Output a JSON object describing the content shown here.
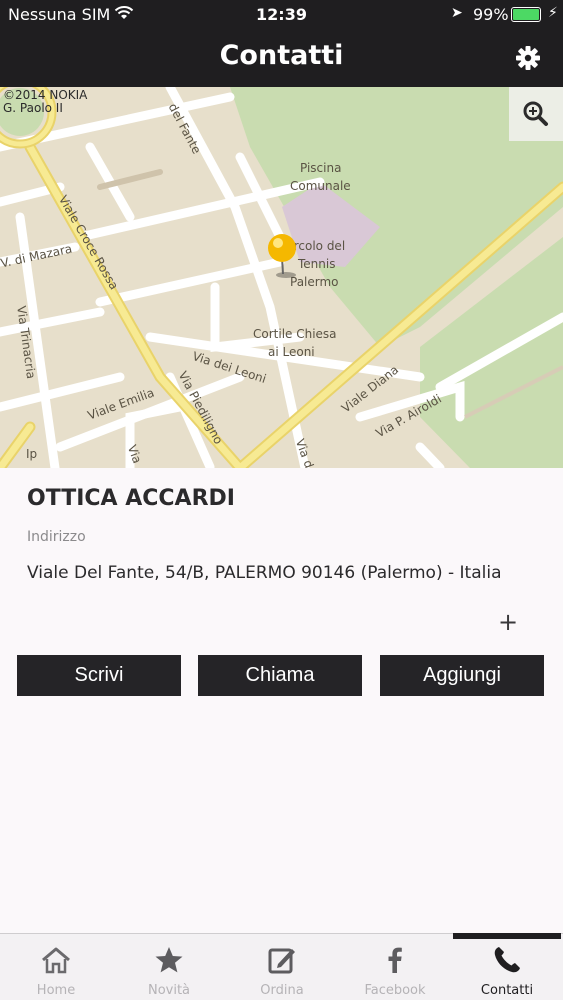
{
  "status": {
    "carrier": "Nessuna SIM",
    "time": "12:39",
    "battery_pct": "99%",
    "battery_level": 0.99,
    "battery_color": "#4cd964"
  },
  "nav": {
    "title": "Contatti",
    "settings_icon": "gear-icon"
  },
  "map": {
    "copyright_line1": "©2014 NOKIA",
    "copyright_line2": "G. Paolo II",
    "zoom_icon": "magnifier-plus-icon",
    "labels": {
      "del_fante": "del Fante",
      "piscina": "Piscina",
      "comunale": "Comunale",
      "circolo": "Circolo del",
      "tennis": "Tennis",
      "palermo": "Palermo",
      "croce_rossa": "Viale Croce Rossa",
      "mazara": "V. di Mazara",
      "trinacria": "Via Trinacria",
      "cortile": "Cortile Chiesa",
      "leoni_place": "ai Leoni",
      "via_leoni": "Via dei Leoni",
      "emilia": "Viale Emilia",
      "piediligno": "Via Piediligno",
      "diana": "Viale Diana",
      "airoldi": "Via P. Airoldi",
      "ip": "Ip",
      "via_p": "Via",
      "via_d": "Via d"
    }
  },
  "store": {
    "name": "OTTICA ACCARDI",
    "address_label": "Indirizzo",
    "address": "Viale Del Fante, 54/B, PALERMO 90146 (Palermo) - Italia",
    "expand_label": "+"
  },
  "actions": {
    "write": "Scrivi",
    "call": "Chiama",
    "add": "Aggiungi"
  },
  "tabs": [
    {
      "label": "Home",
      "icon": "home-icon"
    },
    {
      "label": "Novità",
      "icon": "star-icon"
    },
    {
      "label": "Ordina",
      "icon": "edit-icon"
    },
    {
      "label": "Facebook",
      "icon": "facebook-icon"
    },
    {
      "label": "Contatti",
      "icon": "phone-icon",
      "active": true
    }
  ],
  "colors": {
    "bar": "#1f1e20",
    "button": "#252427",
    "map_road_major": "#f3e27a",
    "map_park": "#c9dcb0"
  }
}
